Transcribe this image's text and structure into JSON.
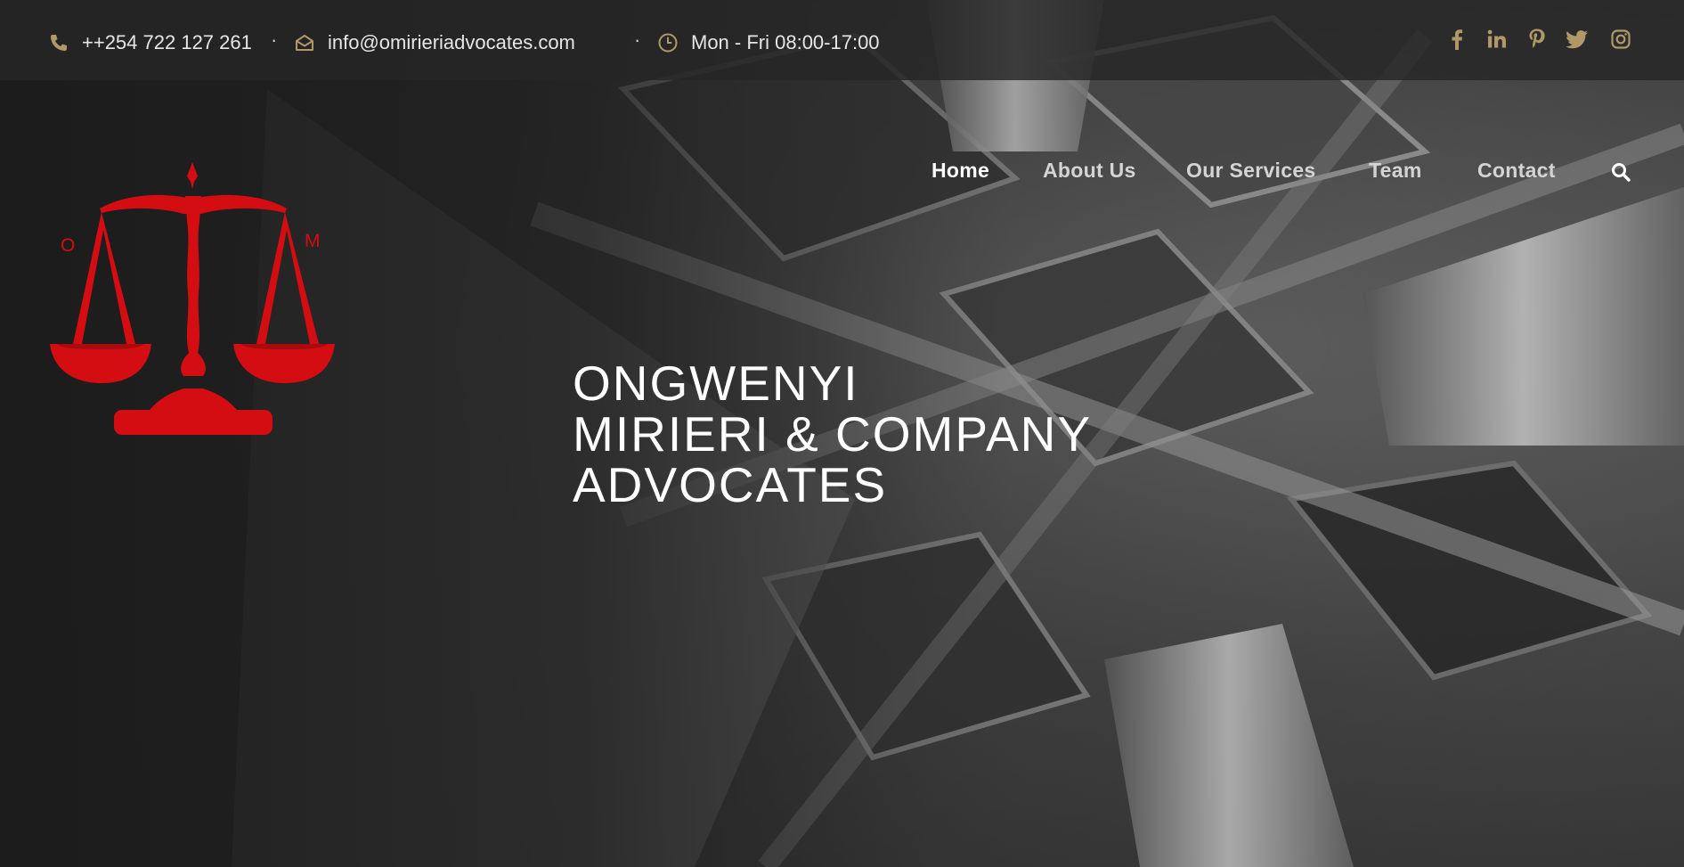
{
  "topbar": {
    "phone": "++254 722 127 261",
    "email": "info@omirieriadvocates.com",
    "hours": "Mon - Fri 08:00-17:00",
    "separator": "·",
    "socials": [
      "facebook-icon",
      "linkedin-icon",
      "pinterest-icon",
      "twitter-icon",
      "instagram-icon"
    ]
  },
  "logo": {
    "letter_left": "O",
    "letter_right": "M"
  },
  "nav": {
    "items": [
      "Home",
      "About Us",
      "Our Services",
      "Team",
      "Contact"
    ],
    "active": "Home",
    "search_icon": "search-icon"
  },
  "hero": {
    "line1": "ONGWENYI",
    "line2": "MIRIERI & COMPANY",
    "line3": "ADVOCATES",
    "background": "black-and-white photo of classical columns and coffered ceiling"
  },
  "colors": {
    "accent_gold": "#b09868",
    "logo_red": "#d40d12",
    "text_light": "#e6e6e6"
  }
}
